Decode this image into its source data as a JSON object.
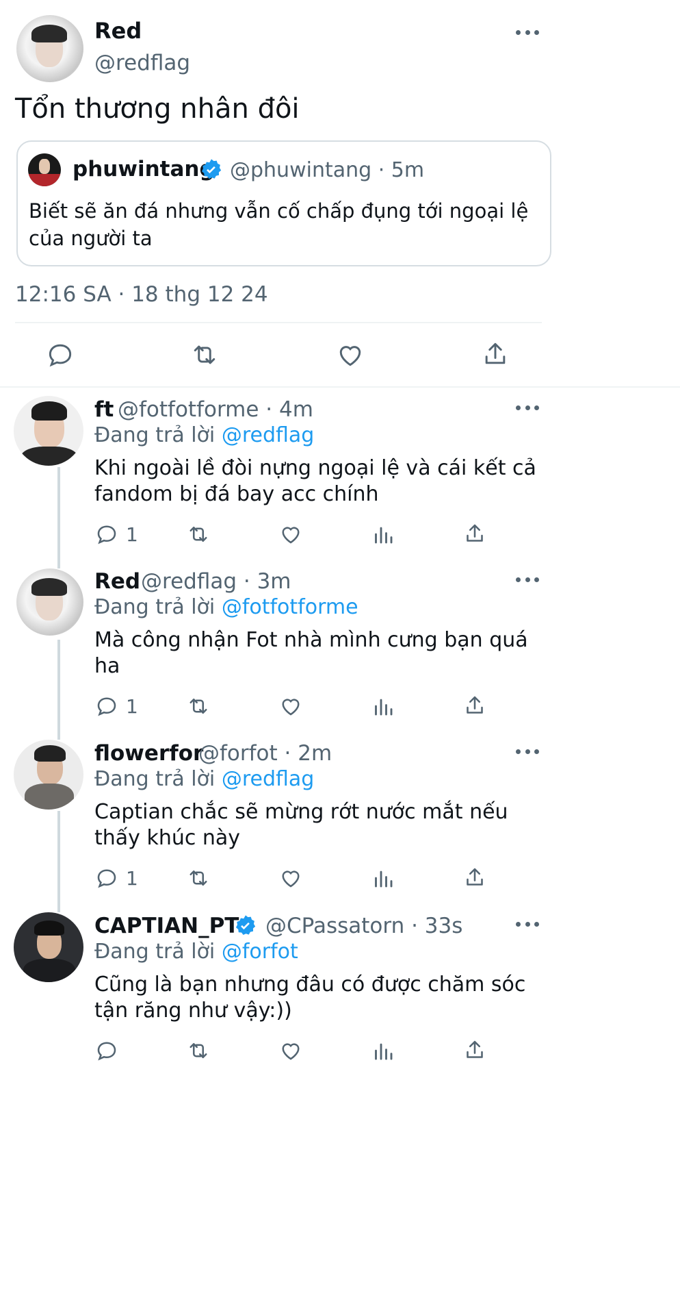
{
  "main_tweet": {
    "name": "Red",
    "handle": "@redflag",
    "text": "Tổn thương nhân đôi",
    "quote": {
      "name": "phuwintang",
      "handle_time": "@phuwintang · 5m",
      "text_line1": "Biết sẽ ăn đá nhưng vẫn cố chấp đụng tới ngoại lệ",
      "text_line2": "của người ta"
    },
    "timestamp": "12:16 SA · 18 thg 12 24"
  },
  "replies": [
    {
      "name": "ft",
      "handle_time": "@fotfotforme · 4m",
      "replying_prefix": "Đang trả lời",
      "replying_to": "@redflag",
      "line1": "Khi ngoài lề đòi nựng ngoại lệ và cái kết cả",
      "line2": "fandom bị đá bay acc chính",
      "reply_count": "1"
    },
    {
      "name": "Red",
      "handle_time": "@redflag · 3m",
      "replying_prefix": "Đang trả lời",
      "replying_to": "@fotfotforme",
      "line1": "Mà công nhận Fot nhà mình cưng bạn quá",
      "line2": "ha",
      "reply_count": "1"
    },
    {
      "name": "flowerfor",
      "handle_time": "@forfot · 2m",
      "replying_prefix": "Đang trả lời",
      "replying_to": "@redflag",
      "line1": "Captian chắc sẽ mừng rớt nước mắt nếu",
      "line2": "thấy khúc này",
      "reply_count": "1"
    },
    {
      "name": "CAPTIAN_PT",
      "handle_time": "@CPassatorn · 33s",
      "replying_prefix": "Đang trả lời",
      "replying_to": "@forfot",
      "line1": "Cũng là bạn nhưng đâu có được chăm sóc",
      "line2": "tận răng như vậy:))",
      "reply_count": ""
    }
  ],
  "colors": {
    "accent": "#1d9bf0",
    "secondary_text": "#536471",
    "divider": "#cfd9de"
  }
}
